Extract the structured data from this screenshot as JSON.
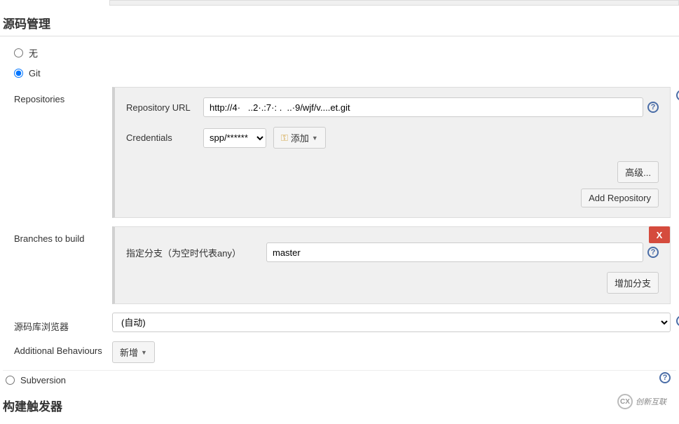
{
  "sections": {
    "scm_title": "源码管理",
    "triggers_title": "构建触发器"
  },
  "scm": {
    "none_label": "无",
    "git_label": "Git",
    "subversion_label": "Subversion"
  },
  "repo": {
    "label": "Repositories",
    "url_label": "Repository URL",
    "url_value": "http://4·   ..2·.:7·: .  ..·9/wjf/v....et.git",
    "cred_label": "Credentials",
    "cred_value": "spp/******",
    "add_label": "添加",
    "advanced_label": "高级...",
    "add_repo_label": "Add Repository"
  },
  "branches": {
    "label": "Branches to build",
    "branch_label": "指定分支（为空时代表any）",
    "branch_value": "master",
    "add_branch_label": "增加分支",
    "close_label": "X"
  },
  "browser": {
    "label": "源码库浏览器",
    "value": "(自动)"
  },
  "behaviours": {
    "label": "Additional Behaviours",
    "add_label": "新增"
  },
  "watermark": "创新互联"
}
